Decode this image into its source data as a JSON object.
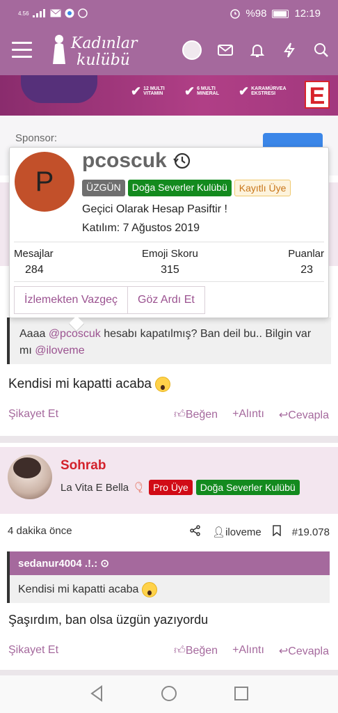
{
  "status_bar": {
    "signal": "4.56",
    "battery": "%98",
    "time": "12:19"
  },
  "header": {
    "logo_line1": "Kadınlar",
    "logo_line2": "kulübü"
  },
  "banner": {
    "features": [
      "12 MULTI VITAMIN",
      "6 MULTI MINERAL",
      "KARAMÜRVEA EKSTRESI"
    ],
    "brand_letter": "E"
  },
  "sponsor": {
    "label": "Sponsor:"
  },
  "popup": {
    "avatar_letter": "P",
    "username": "pcoscuk",
    "badges": [
      "ÜZGÜN",
      "Doğa Severler Kulübü",
      "Kayıtlı Üye"
    ],
    "status": "Geçici Olarak Hesap Pasiftir !",
    "joined": "Katılım: 7 Ağustos 2019",
    "stats": [
      {
        "label": "Mesajlar",
        "value": "284"
      },
      {
        "label": "Emoji Skoru",
        "value": "315"
      },
      {
        "label": "Puanlar",
        "value": "23"
      }
    ],
    "buttons": [
      "İzlemekten Vazgeç",
      "Göz Ardı Et"
    ]
  },
  "post1": {
    "quote_prefix": "Aaaa ",
    "quote_mention": "@pcoscuk",
    "quote_mid": " hesabı kapatılmış? Ban deil bu.. Bilgin var mı ",
    "quote_mention2": "@iloveme",
    "message": "Kendisi mi kapatti acaba",
    "actions": {
      "report": "Şikayet Et",
      "like": "Beğen",
      "quote": "Alıntı",
      "reply": "Cevapla"
    }
  },
  "post2": {
    "author": "Sohrab",
    "title": "La Vita E Bella",
    "badges": [
      "Pro Üye",
      "Doğa Severler Kulübü"
    ],
    "time": "4 dakika önce",
    "reply_to": "iloveme",
    "post_number": "#19.078",
    "quote_author": "sedanur4004 .!.:",
    "quote_text": "Kendisi mi kapatti acaba",
    "message": "Şaşırdım, ban olsa üzgün yazıyordu",
    "actions": {
      "report": "Şikayet Et",
      "like": "Beğen",
      "quote": "Alıntı",
      "reply": "Cevapla"
    }
  },
  "colors": {
    "brand": "#a5699d",
    "accent_red": "#d10b16",
    "accent_green": "#138a1e"
  }
}
